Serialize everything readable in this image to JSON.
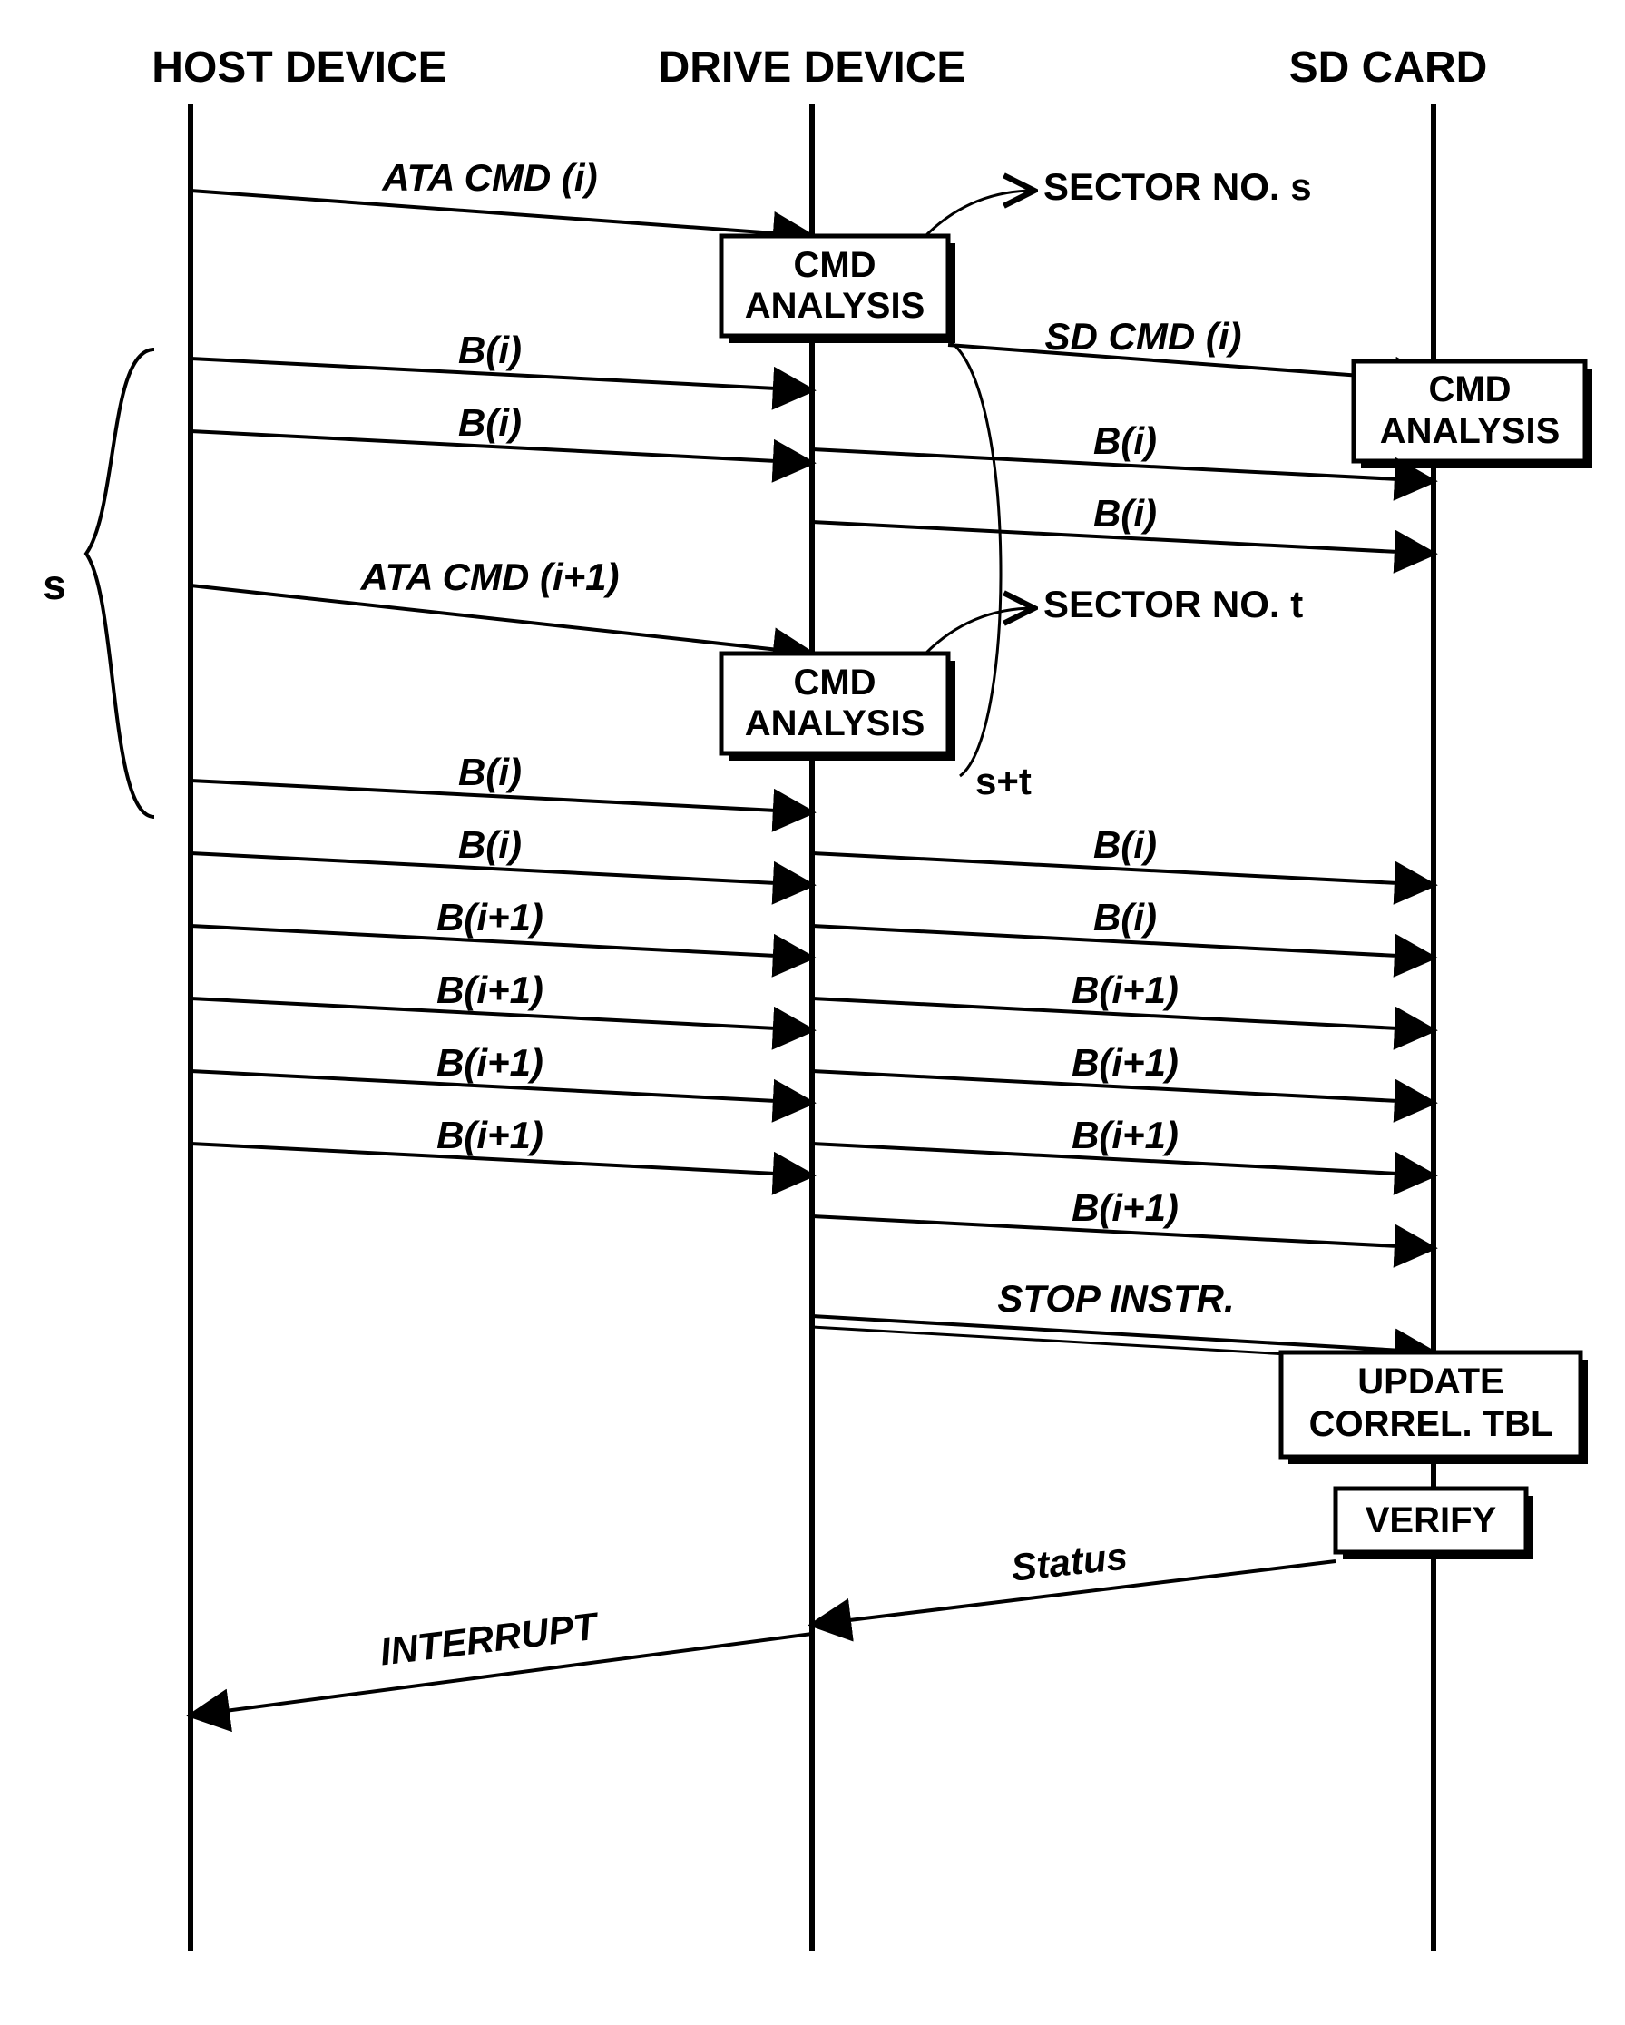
{
  "actors": {
    "host": "HOST DEVICE",
    "drive": "DRIVE DEVICE",
    "sd": "SD CARD"
  },
  "arrows": {
    "a1": "ATA CMD (i)",
    "a2": "B(i)",
    "a3": "B(i)",
    "a4": "SD CMD (i)",
    "a5": "B(i)",
    "a6": "B(i)",
    "a7": "ATA CMD (i+1)",
    "a8": "B(i)",
    "a9": "B(i)",
    "a10": "B(i+1)",
    "a11": "B(i+1)",
    "a12": "B(i+1)",
    "a13": "B(i+1)",
    "a14": "B(i)",
    "a15": "B(i)",
    "a16": "B(i+1)",
    "a17": "B(i+1)",
    "a18": "B(i+1)",
    "a19": "B(i+1)",
    "a20": "STOP INSTR.",
    "a21": "Status",
    "a22": "INTERRUPT"
  },
  "annotations": {
    "sector_s": "SECTOR NO. s",
    "sector_t": "SECTOR NO. t",
    "s_brace": "s",
    "splus_t": "s+t"
  },
  "boxes": {
    "cmd_analysis_1": "CMD\nANALYSIS",
    "cmd_analysis_2": "CMD\nANALYSIS",
    "cmd_analysis_3": "CMD\nANALYSIS",
    "update_tbl": "UPDATE\nCORREL. TBL",
    "verify": "VERIFY"
  }
}
